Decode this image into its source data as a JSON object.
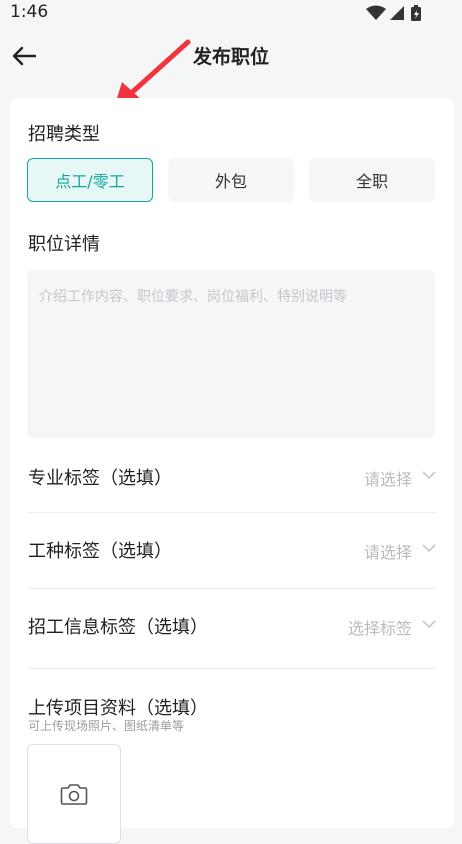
{
  "status_bar": {
    "time": "1:46"
  },
  "header": {
    "title": "发布职位"
  },
  "recruit_type": {
    "title": "招聘类型",
    "options": [
      "点工/零工",
      "外包",
      "全职"
    ],
    "selected": "点工/零工"
  },
  "job_detail": {
    "title": "职位详情",
    "placeholder": "介绍工作内容、职位要求、岗位福利、特别说明等"
  },
  "selects": [
    {
      "label": "专业标签（选填）",
      "value": "请选择"
    },
    {
      "label": "工种标签（选填）",
      "value": "请选择"
    },
    {
      "label": "招工信息标签（选填）",
      "value": "选择标签"
    }
  ],
  "upload": {
    "title": "上传项目资料（选填）",
    "subtitle": "可上传现场照片、图纸清单等"
  },
  "colors": {
    "accent": "#14a89c",
    "accent_bg": "#e7f7f5",
    "annotation_arrow": "#f0363c"
  }
}
